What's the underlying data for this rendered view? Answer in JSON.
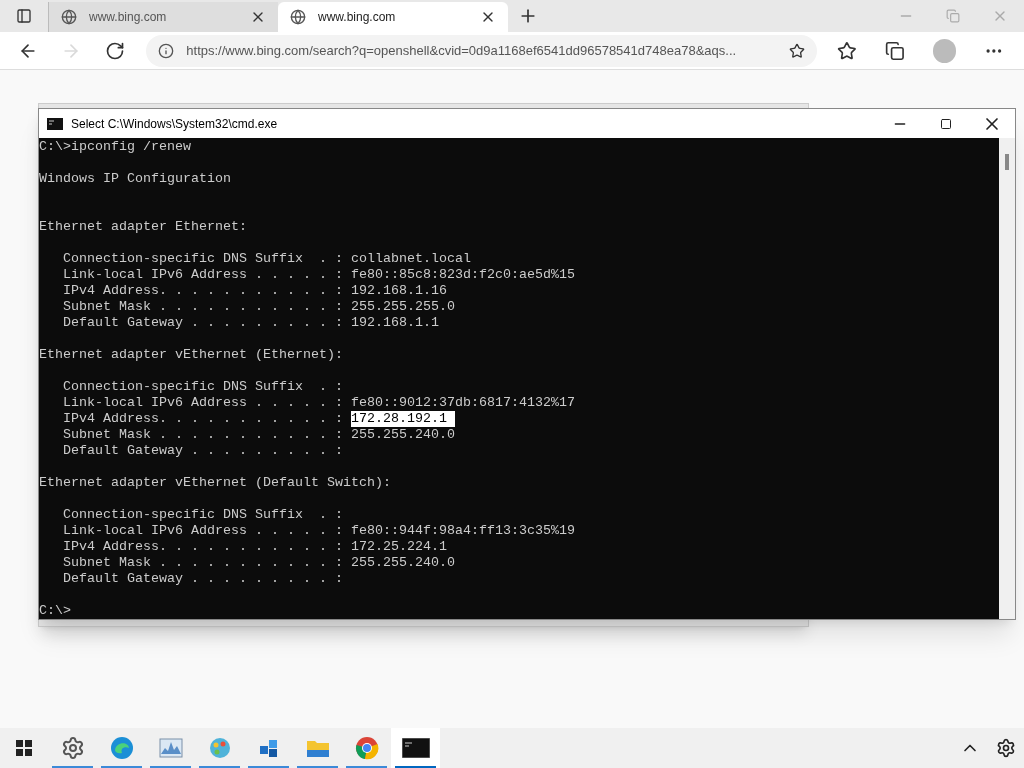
{
  "browser": {
    "tabs": [
      {
        "title": "www.bing.com",
        "selected": false
      },
      {
        "title": "www.bing.com",
        "selected": true
      }
    ],
    "nav": [
      {
        "kind": "back",
        "disabled": false
      },
      {
        "kind": "forward",
        "disabled": true
      },
      {
        "kind": "refresh",
        "disabled": false
      }
    ],
    "url": "https://www.bing.com/search?q=openshell&cvid=0d9a1168ef6541dd96578541d748ea78&aqs..."
  },
  "console_window": {
    "title": "Select C:\\Windows\\System32\\cmd.exe",
    "lines": [
      {
        "parts": [
          {
            "text": "C:\\>ipconfig /renew",
            "selected": false
          }
        ]
      },
      {
        "kind": "blank"
      },
      {
        "parts": [
          {
            "text": "Windows IP Configuration",
            "selected": false
          }
        ]
      },
      {
        "kind": "blank"
      },
      {
        "kind": "blank"
      },
      {
        "parts": [
          {
            "text": "Ethernet adapter Ethernet:",
            "selected": false
          }
        ]
      },
      {
        "kind": "blank"
      },
      {
        "parts": [
          {
            "text": "   Connection-specific DNS Suffix  . : collabnet.local",
            "selected": false
          }
        ]
      },
      {
        "parts": [
          {
            "text": "   Link-local IPv6 Address . . . . . : fe80::85c8:823d:f2c0:ae5d%15",
            "selected": false
          }
        ]
      },
      {
        "parts": [
          {
            "text": "   IPv4 Address. . . . . . . . . . . : 192.168.1.16",
            "selected": false
          }
        ]
      },
      {
        "parts": [
          {
            "text": "   Subnet Mask . . . . . . . . . . . : 255.255.255.0",
            "selected": false
          }
        ]
      },
      {
        "parts": [
          {
            "text": "   Default Gateway . . . . . . . . . : 192.168.1.1",
            "selected": false
          }
        ]
      },
      {
        "kind": "blank"
      },
      {
        "parts": [
          {
            "text": "Ethernet adapter vEthernet (Ethernet):",
            "selected": false
          }
        ]
      },
      {
        "kind": "blank"
      },
      {
        "parts": [
          {
            "text": "   Connection-specific DNS Suffix  . :",
            "selected": false
          }
        ]
      },
      {
        "parts": [
          {
            "text": "   Link-local IPv6 Address . . . . . : fe80::9012:37db:6817:4132%17",
            "selected": false
          }
        ]
      },
      {
        "parts": [
          {
            "text": "   IPv4 Address. . . . . . . . . . . : ",
            "selected": false
          },
          {
            "text": "172.28.192.1 ",
            "selected": true
          }
        ]
      },
      {
        "parts": [
          {
            "text": "   Subnet Mask . . . . . . . . . . . : 255.255.240.0",
            "selected": false
          }
        ]
      },
      {
        "parts": [
          {
            "text": "   Default Gateway . . . . . . . . . :",
            "selected": false
          }
        ]
      },
      {
        "kind": "blank"
      },
      {
        "parts": [
          {
            "text": "Ethernet adapter vEthernet (Default Switch):",
            "selected": false
          }
        ]
      },
      {
        "kind": "blank"
      },
      {
        "parts": [
          {
            "text": "   Connection-specific DNS Suffix  . :",
            "selected": false
          }
        ]
      },
      {
        "parts": [
          {
            "text": "   Link-local IPv6 Address . . . . . : fe80::944f:98a4:ff13:3c35%19",
            "selected": false
          }
        ]
      },
      {
        "parts": [
          {
            "text": "   IPv4 Address. . . . . . . . . . . : 172.25.224.1",
            "selected": false
          }
        ]
      },
      {
        "parts": [
          {
            "text": "   Subnet Mask . . . . . . . . . . . : 255.255.240.0",
            "selected": false
          }
        ]
      },
      {
        "parts": [
          {
            "text": "   Default Gateway . . . . . . . . . :",
            "selected": false
          }
        ]
      },
      {
        "kind": "blank"
      },
      {
        "parts": [
          {
            "text": "C:\\>",
            "selected": false
          }
        ]
      }
    ]
  },
  "taskbar": {
    "apps": [
      {
        "kind": "settings",
        "running": true,
        "selected": false
      },
      {
        "kind": "edge",
        "running": true,
        "selected": false
      },
      {
        "kind": "monitor",
        "running": true,
        "selected": false
      },
      {
        "kind": "paint",
        "running": true,
        "selected": false
      },
      {
        "kind": "cube",
        "running": true,
        "selected": false
      },
      {
        "kind": "folder",
        "running": true,
        "selected": false
      },
      {
        "kind": "chrome",
        "running": true,
        "selected": false
      },
      {
        "kind": "terminal",
        "running": true,
        "selected": true
      }
    ]
  }
}
